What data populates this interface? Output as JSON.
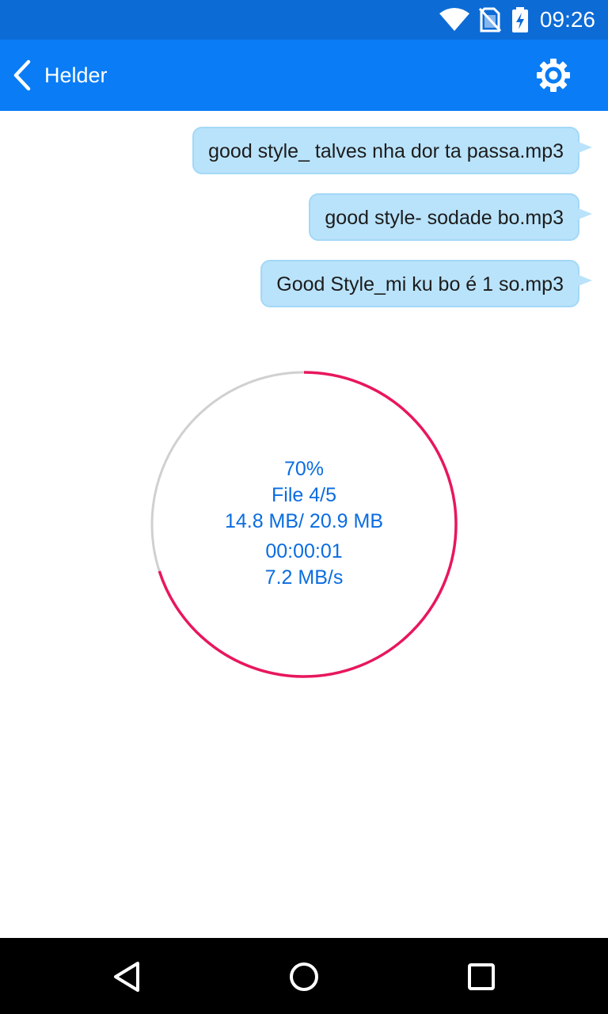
{
  "status_bar": {
    "time": "09:26",
    "icons": [
      "wifi-icon",
      "no-sim-icon",
      "battery-charging-icon"
    ]
  },
  "app_bar": {
    "title": "Helder",
    "back_icon": "chevron-left-icon",
    "settings_icon": "gear-icon"
  },
  "messages": [
    {
      "text": "good style_ talves nha dor ta passa.mp3"
    },
    {
      "text": "good style- sodade bo.mp3"
    },
    {
      "text": "Good Style_mi ku bo é 1 so.mp3"
    }
  ],
  "transfer": {
    "progress": 0.7,
    "percent_label": "70%",
    "file_label": "File 4/5",
    "size_label": "14.8 MB/ 20.9 MB",
    "elapsed": "00:00:01",
    "speed": "7.2 MB/s"
  },
  "colors": {
    "status_bar": "#0d6bd6",
    "app_bar": "#0a7cf5",
    "bubble": "#b9e3fb",
    "ring_progress": "#e8175d",
    "ring_track": "#d0d0d0",
    "progress_text": "#0a6de0"
  },
  "nav_bar": {
    "icons": [
      "back-triangle-icon",
      "home-circle-icon",
      "recents-square-icon"
    ]
  }
}
